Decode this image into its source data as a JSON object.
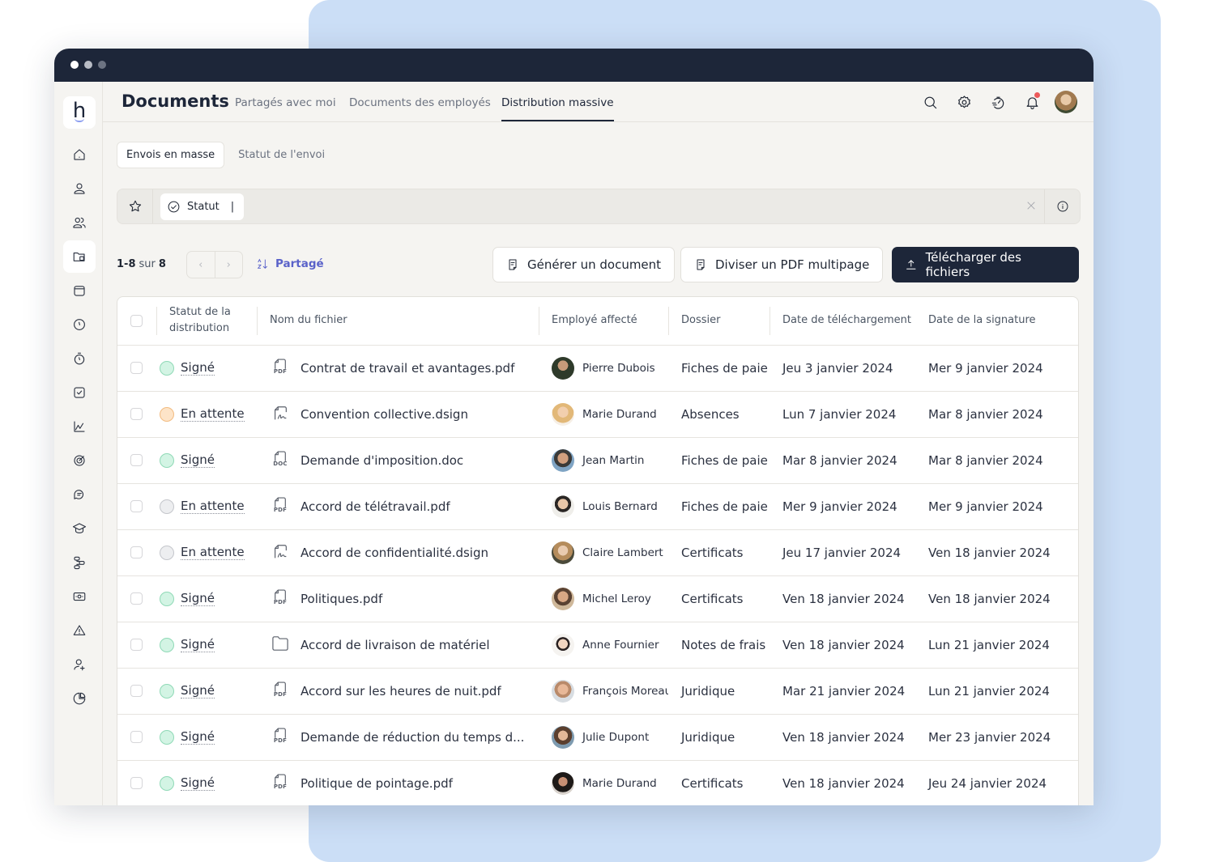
{
  "window": {
    "title": "Documents"
  },
  "nav": {
    "tabs": [
      {
        "label": "Partagés avec moi",
        "active": false
      },
      {
        "label": "Documents des employés",
        "active": false
      },
      {
        "label": "Distribution massive",
        "active": true
      }
    ]
  },
  "top_icons": [
    "search-icon",
    "settings-icon",
    "speedometer-icon",
    "bell-icon",
    "user-avatar"
  ],
  "notification": {
    "has_unread": true,
    "dot_color": "#ec5a5a"
  },
  "sidebar": {
    "logo": "h",
    "items": [
      {
        "icon": "home-icon"
      },
      {
        "icon": "user-icon"
      },
      {
        "icon": "users-icon"
      },
      {
        "icon": "folder-icon",
        "active": true
      },
      {
        "icon": "calendar-icon"
      },
      {
        "icon": "clock-icon"
      },
      {
        "icon": "stopwatch-icon"
      },
      {
        "icon": "checkbox-icon"
      },
      {
        "icon": "chart-line-icon"
      },
      {
        "icon": "target-icon"
      },
      {
        "icon": "chat-icon"
      },
      {
        "icon": "graduation-cap-icon"
      },
      {
        "icon": "workflow-icon"
      },
      {
        "icon": "money-icon"
      },
      {
        "icon": "warning-icon"
      },
      {
        "icon": "user-add-icon"
      },
      {
        "icon": "pie-chart-icon"
      }
    ]
  },
  "subtabs": [
    {
      "label": "Envois en masse",
      "active": true
    },
    {
      "label": "Statut de l'envoi",
      "active": false
    }
  ],
  "filter": {
    "chip_label": "Statut",
    "chip_cursor": "|"
  },
  "toolbar": {
    "range": "1-8",
    "sur": "sur",
    "total": "8",
    "sort_label": "Partagé",
    "generate_label": "Générer un document",
    "split_label": "Diviser un PDF multipage",
    "upload_label": "Télécharger des fichiers"
  },
  "colors": {
    "primary": "#1d2639",
    "accent": "#5a62c9",
    "status_signed": "#d3f4e4",
    "status_signed_border": "#8fd9b6",
    "status_pending_orange": "#fde4c8",
    "status_pending_orange_border": "#f2bb80",
    "status_pending_grey": "#edeef0",
    "status_pending_grey_border": "#c4c6cb"
  },
  "table": {
    "columns": [
      "",
      "Statut de la distribution",
      "Nom du fichier",
      "Employé affecté",
      "Dossier",
      "Date de téléchargement",
      "Date de la signature"
    ],
    "rows": [
      {
        "status": "Signé",
        "status_kind": "signed",
        "file": "Contrat de travail et avantages.pdf",
        "file_type": "PDF",
        "employee": "Pierre Dubois",
        "folder": "Fiches de paie",
        "upload_date": "Jeu 3 janvier 2024",
        "sign_date": "Mer 9 janvier 2024"
      },
      {
        "status": "En attente",
        "status_kind": "pending-orange",
        "file": "Convention collective.dsign",
        "file_type": "SIGN",
        "employee": "Marie Durand",
        "folder": "Absences",
        "upload_date": "Lun 7 janvier 2024",
        "sign_date": "Mar 8 janvier 2024"
      },
      {
        "status": "Signé",
        "status_kind": "signed",
        "file": "Demande d'imposition.doc",
        "file_type": "DOC",
        "employee": "Jean Martin",
        "folder": "Fiches de paie",
        "upload_date": "Mar 8 janvier 2024",
        "sign_date": "Mar 8 janvier 2024"
      },
      {
        "status": "En attente",
        "status_kind": "pending-grey",
        "file": "Accord de télétravail.pdf",
        "file_type": "PDF",
        "employee": "Louis Bernard",
        "folder": "Fiches de paie",
        "upload_date": "Mer 9 janvier 2024",
        "sign_date": "Mer 9 janvier 2024"
      },
      {
        "status": "En attente",
        "status_kind": "pending-grey",
        "file": "Accord de confidentialité.dsign",
        "file_type": "SIGN",
        "employee": "Claire Lambert",
        "folder": "Certificats",
        "upload_date": "Jeu 17 janvier 2024",
        "sign_date": "Ven 18 janvier 2024"
      },
      {
        "status": "Signé",
        "status_kind": "signed",
        "file": "Politiques.pdf",
        "file_type": "PDF",
        "employee": "Michel Leroy",
        "folder": "Certificats",
        "upload_date": "Ven 18 janvier 2024",
        "sign_date": "Ven 18 janvier 2024"
      },
      {
        "status": "Signé",
        "status_kind": "signed",
        "file": "Accord de livraison de matériel",
        "file_type": "FOLDER",
        "employee": "Anne Fournier",
        "folder": "Notes de frais",
        "upload_date": "Ven 18 janvier 2024",
        "sign_date": "Lun 21 janvier 2024"
      },
      {
        "status": "Signé",
        "status_kind": "signed",
        "file": "Accord sur les heures de nuit.pdf",
        "file_type": "PDF",
        "employee": "François Moreau",
        "folder": "Juridique",
        "upload_date": "Mar 21 janvier 2024",
        "sign_date": "Lun 21 janvier 2024"
      },
      {
        "status": "Signé",
        "status_kind": "signed",
        "file": "Demande de réduction du temps d...",
        "file_type": "PDF",
        "employee": "Julie Dupont",
        "folder": "Juridique",
        "upload_date": "Ven 18 janvier 2024",
        "sign_date": "Mer 23 janvier 2024"
      },
      {
        "status": "Signé",
        "status_kind": "signed",
        "file": "Politique de pointage.pdf",
        "file_type": "PDF",
        "employee": "Marie Durand",
        "folder": "Certificats",
        "upload_date": "Ven 18 janvier 2024",
        "sign_date": "Jeu 24 janvier 2024"
      }
    ]
  }
}
